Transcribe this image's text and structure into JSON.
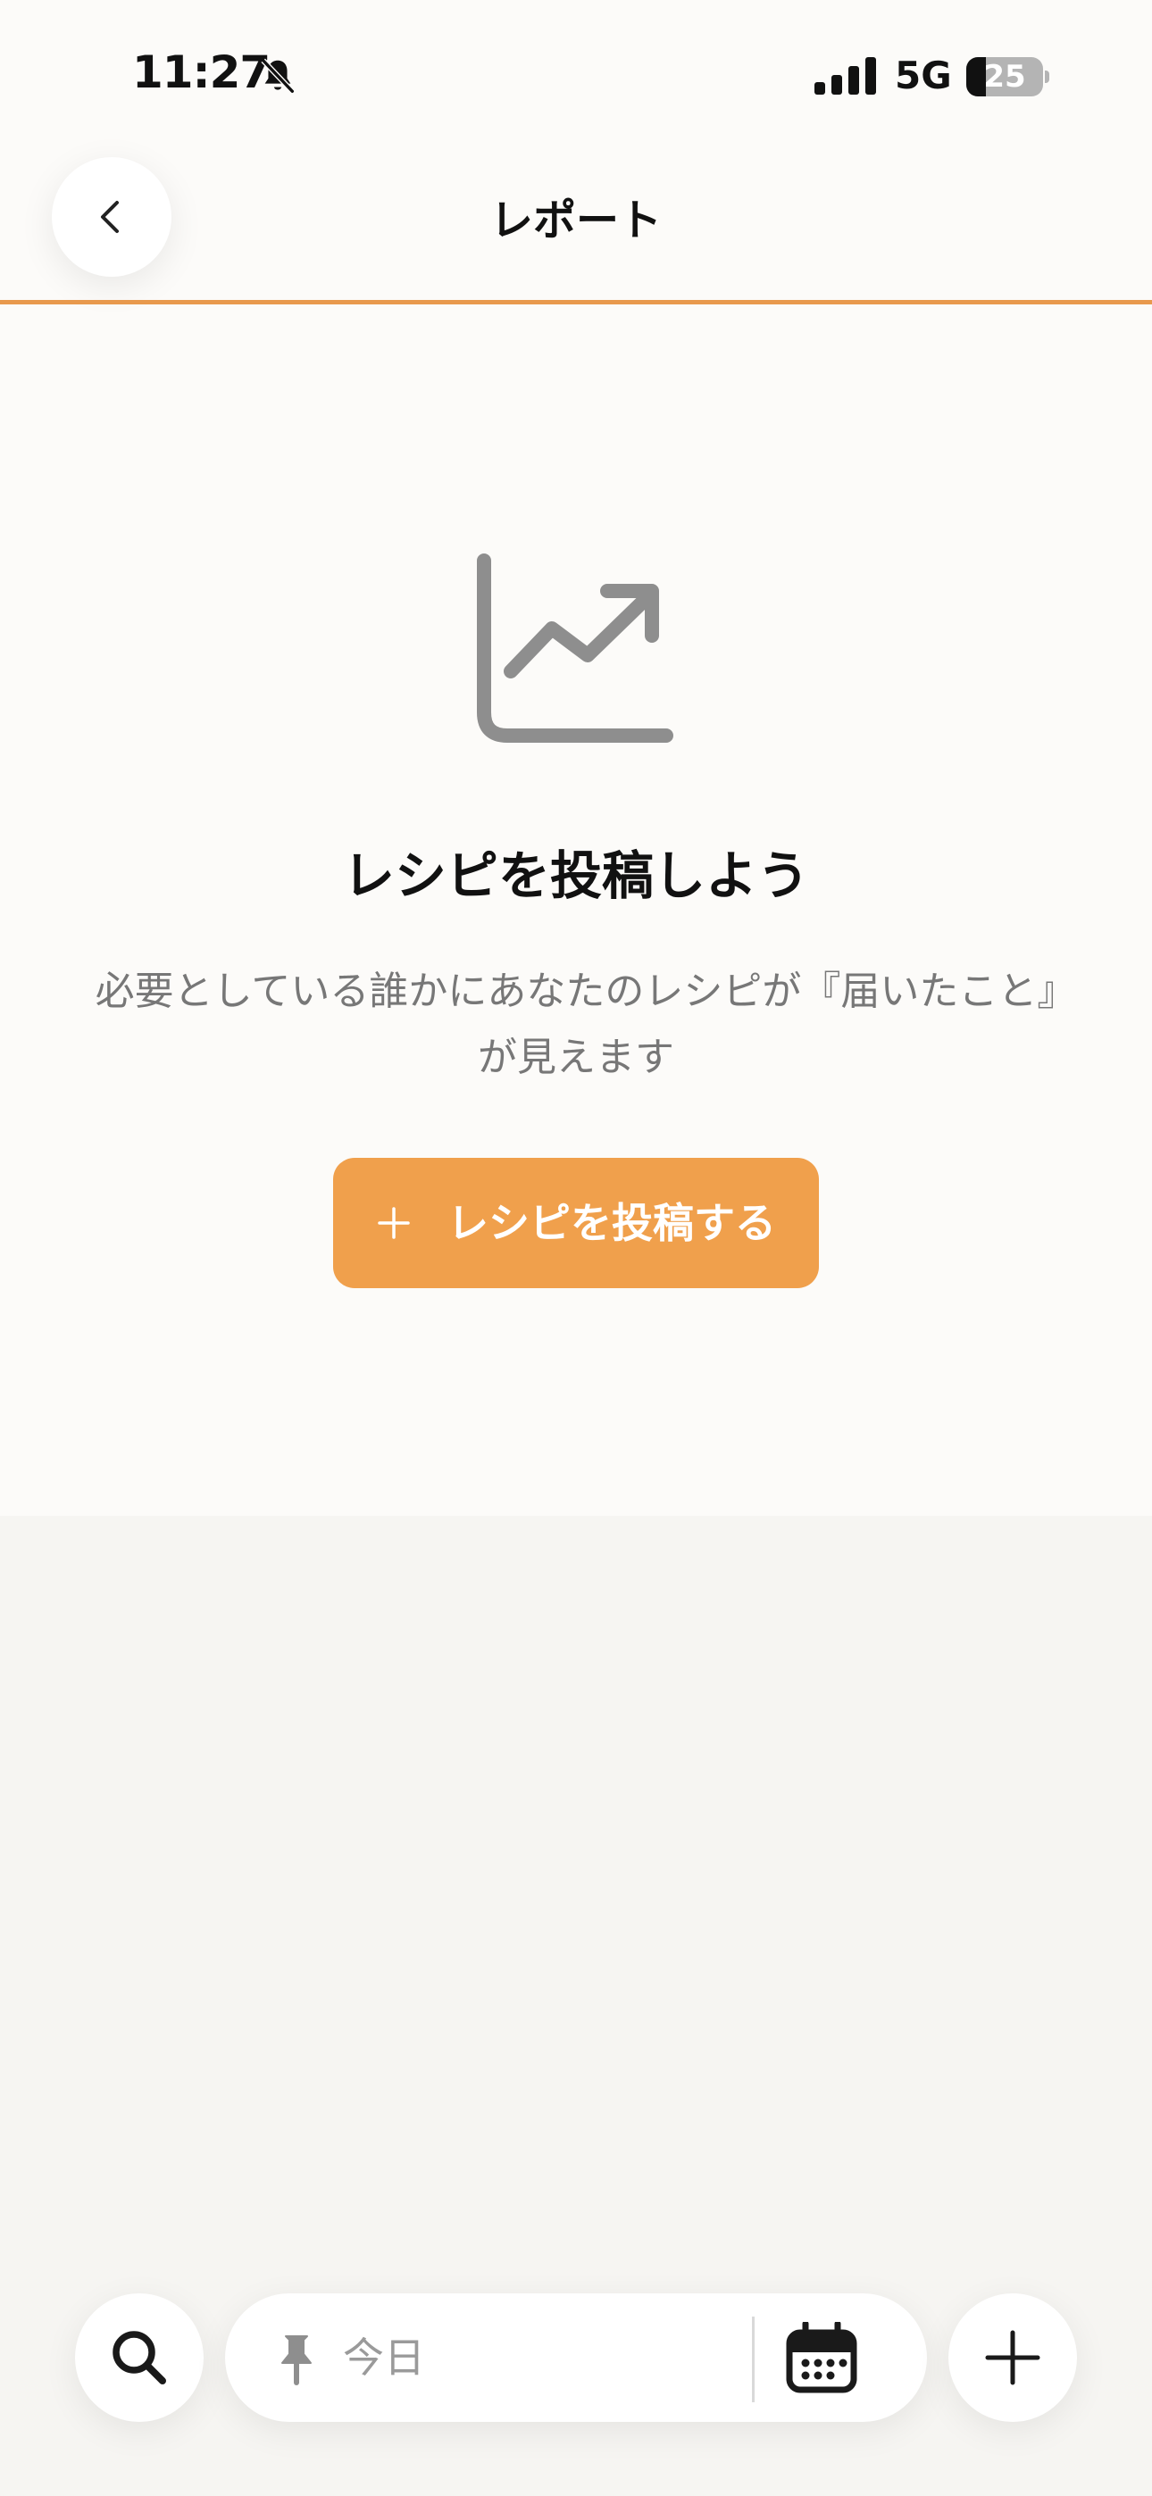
{
  "status_bar": {
    "time": "11:27",
    "network": "5G",
    "battery": "25"
  },
  "header": {
    "title": "レポート"
  },
  "empty_state": {
    "title": "レシピを投稿しよう",
    "description": "必要としている誰かにあなたのレシピが『届いたこと』が見えます",
    "button_label": "レシピを投稿する"
  },
  "bottom_bar": {
    "date_value": "今日"
  },
  "colors": {
    "accent": "#f0a04c",
    "header_line": "#e8994d",
    "icon_gray": "#8e8e8e"
  }
}
